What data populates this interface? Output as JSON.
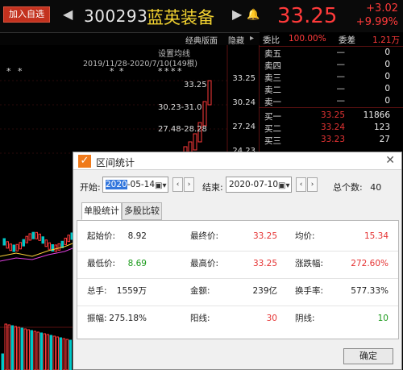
{
  "header": {
    "add_label": "加入自选",
    "code": "300293",
    "name": "蓝英装备",
    "price": "33.25",
    "change": "+3.02",
    "change_pct": "+9.99%"
  },
  "toolbar": {
    "classic": "经典版面",
    "hide": "隐藏",
    "set_line": "设置均线",
    "date_range": "2019/11/28-2020/7/10(149根)"
  },
  "chart": {
    "y_labels": [
      "33.25",
      "30.24",
      "27.24",
      "24.23"
    ],
    "price_labels": [
      "33.25",
      "30.23-31.0",
      "27.48-28.28"
    ]
  },
  "book": {
    "ratio_label": "委比",
    "ratio": "100.00%",
    "diff_label": "委差",
    "diff": "1.21万",
    "asks": [
      {
        "label": "卖五",
        "price": "—",
        "vol": "0"
      },
      {
        "label": "卖四",
        "price": "—",
        "vol": "0"
      },
      {
        "label": "卖三",
        "price": "—",
        "vol": "0"
      },
      {
        "label": "卖二",
        "price": "—",
        "vol": "0"
      },
      {
        "label": "卖一",
        "price": "—",
        "vol": "0"
      }
    ],
    "bids": [
      {
        "label": "买一",
        "price": "33.25",
        "vol": "11866"
      },
      {
        "label": "买二",
        "price": "33.24",
        "vol": "123"
      },
      {
        "label": "买三",
        "price": "33.23",
        "vol": "27"
      }
    ]
  },
  "dialog": {
    "title": "区间统计",
    "start_label": "开始:",
    "start_year": "2020",
    "start_rest": "-05-14",
    "end_label": "结束:",
    "end_date": "2020-07-10",
    "total_label": "总个数:",
    "total": "40",
    "tab_single": "单股统计",
    "tab_multi": "多股比较",
    "ok": "确定",
    "stats": [
      [
        {
          "k": "起始价:",
          "v": "8.92",
          "c": ""
        },
        {
          "k": "最终价:",
          "v": "33.25",
          "c": "red"
        },
        {
          "k": "均价:",
          "v": "15.34",
          "c": "red"
        }
      ],
      [
        {
          "k": "最低价:",
          "v": "8.69",
          "c": "green"
        },
        {
          "k": "最高价:",
          "v": "33.25",
          "c": "red"
        },
        {
          "k": "涨跌幅:",
          "v": "272.60%",
          "c": "red"
        }
      ],
      [
        {
          "k": "总手:",
          "v": "1559万",
          "c": ""
        },
        {
          "k": "金额:",
          "v": "239亿",
          "c": ""
        },
        {
          "k": "换手率:",
          "v": "577.33%",
          "c": ""
        }
      ],
      [
        {
          "k": "振幅:",
          "v": "275.18%",
          "c": ""
        },
        {
          "k": "阳线:",
          "v": "30",
          "c": "red"
        },
        {
          "k": "阴线:",
          "v": "10",
          "c": "green"
        }
      ]
    ]
  }
}
